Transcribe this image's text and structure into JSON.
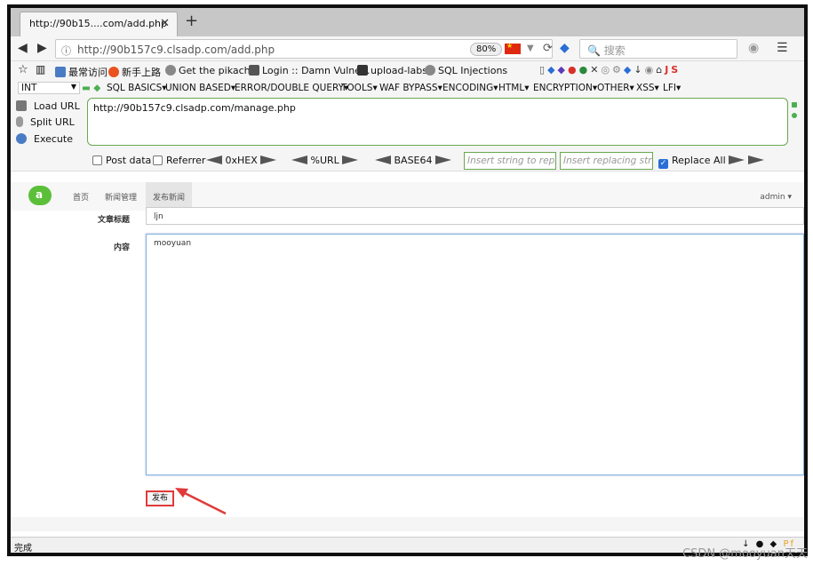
{
  "browser": {
    "tab_title": "http://90b15....com/add.php",
    "tab_close": "✕",
    "new_tab": "+",
    "address": "http://90b157c9.clsadp.com/add.php",
    "zoom": "80%",
    "search_placeholder": "搜索",
    "reload": "⟳"
  },
  "bookmarks": [
    {
      "label": "最常访问",
      "color": "#4a7cc4"
    },
    {
      "label": "新手上路",
      "color": "#e8531f"
    },
    {
      "label": "Get the pikachu",
      "color": "#888888"
    },
    {
      "label": "Login :: Damn Vulne...",
      "color": "#555555"
    },
    {
      "label": "upload-labs",
      "color": "#333333"
    },
    {
      "label": "SQL Injections",
      "color": "#888888"
    }
  ],
  "hackbar": {
    "select_value": "INT",
    "menu": [
      "SQL BASICS",
      "UNION BASED",
      "ERROR/DOUBLE QUERY",
      "TOOLS",
      "WAF BYPASS",
      "ENCODING",
      "HTML",
      "ENCRYPTION",
      "OTHER",
      "XSS",
      "LFI"
    ],
    "load_url": "Load URL",
    "split_url": "Split URL",
    "execute": "Execute",
    "url_value": "http://90b157c9.clsadp.com/manage.php",
    "post_data": "Post data",
    "referrer": "Referrer",
    "hex": "0xHEX",
    "urlenc": "%URL",
    "base64": "BASE64",
    "insert_placeholder": "Insert string to replace",
    "replacing_placeholder": "Insert replacing string",
    "replace_all": "Replace All"
  },
  "app": {
    "nav": [
      "首页",
      "新闻管理",
      "发布新闻"
    ],
    "admin": "admin ▾",
    "title_label": "文章标题",
    "title_value": "ljn",
    "content_label": "内容",
    "content_value": "mooyuan",
    "publish_button": "发布"
  },
  "status": {
    "text": "完成",
    "watermark": "CSDN @mooyuan天天"
  },
  "colors": {
    "highlight": "#e03a3a",
    "hackbar_border": "#6aa84f",
    "logo": "#5cbf3a"
  }
}
